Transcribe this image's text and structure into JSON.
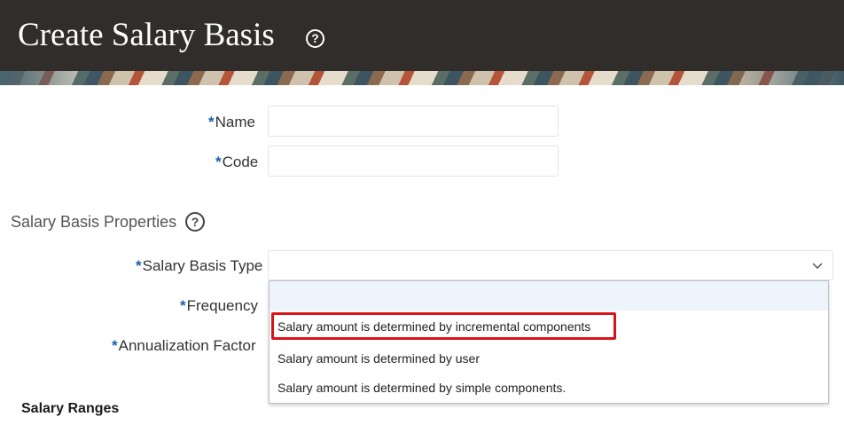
{
  "page": {
    "title": "Create Salary Basis",
    "help_glyph": "?"
  },
  "form": {
    "required_marker": "*",
    "name_label": "Name",
    "name_value": "",
    "code_label": "Code",
    "code_value": ""
  },
  "properties": {
    "section_title": "Salary Basis Properties",
    "help_glyph": "?",
    "salary_basis_type_label": "Salary Basis Type",
    "salary_basis_type_value": "",
    "frequency_label": "Frequency",
    "annualization_label": "Annualization Factor",
    "options": [
      "",
      "Salary amount is determined by incremental components",
      "Salary amount is determined by user",
      "Salary amount is determined by simple components."
    ]
  },
  "ranges": {
    "section_title": "Salary Ranges"
  },
  "colors": {
    "header_bg": "#312d2a",
    "required_marker": "#1a5ea8",
    "highlight_border": "#d7141a",
    "selected_option_bg": "#eef4fc"
  },
  "icons": [
    "help-icon",
    "chevron-down-icon"
  ]
}
